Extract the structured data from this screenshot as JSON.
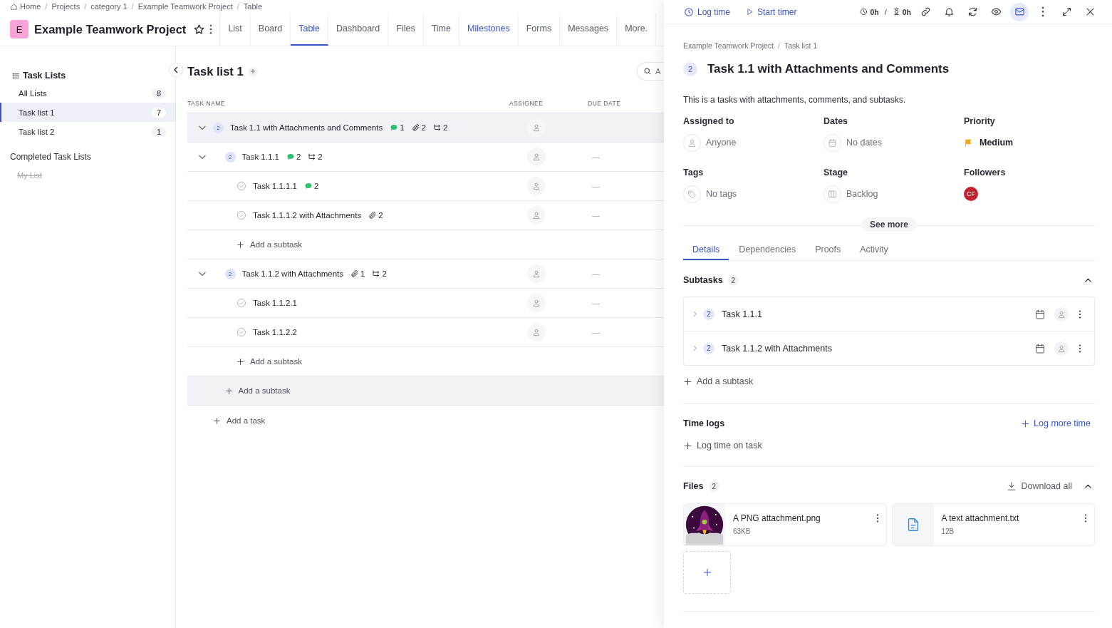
{
  "breadcrumbs": {
    "separator": "/",
    "items": [
      {
        "label": "Home",
        "kind": "home"
      },
      {
        "label": "Projects"
      },
      {
        "label": "category 1"
      },
      {
        "label": "Example Teamwork Project"
      },
      {
        "label": "Table"
      }
    ]
  },
  "project": {
    "initial": "E",
    "title": "Example Teamwork Project",
    "starred": false
  },
  "nav_tabs": [
    {
      "label": "List",
      "selected": false,
      "highlighted": false
    },
    {
      "label": "Board",
      "selected": false,
      "highlighted": false
    },
    {
      "label": "Table",
      "selected": true,
      "highlighted": false
    },
    {
      "label": "Dashboard",
      "selected": false,
      "highlighted": false
    },
    {
      "label": "Files",
      "selected": false,
      "highlighted": false
    },
    {
      "label": "Time",
      "selected": false,
      "highlighted": false
    },
    {
      "label": "Milestones",
      "selected": false,
      "highlighted": true
    },
    {
      "label": "Forms",
      "selected": false,
      "highlighted": false
    },
    {
      "label": "Messages",
      "selected": false,
      "highlighted": false
    },
    {
      "label": "More.",
      "selected": false,
      "highlighted": false
    }
  ],
  "sidebar": {
    "title": "Task Lists",
    "items": [
      {
        "label": "All Lists",
        "count": "8",
        "selected": false
      },
      {
        "label": "Task list 1",
        "count": "7",
        "selected": true
      },
      {
        "label": "Task list 2",
        "count": "1",
        "selected": false
      }
    ],
    "completed_title": "Completed Task Lists",
    "completed_items": [
      {
        "label": "My List",
        "completed": true
      }
    ]
  },
  "task_list": {
    "title": "Task list 1",
    "search_placeholder": "A",
    "columns": [
      "TASK NAME",
      "ASSIGNEE",
      "DUE DATE"
    ],
    "tasks": [
      {
        "kind": "parent",
        "name": "Task 1.1 with Attachments and Comments",
        "badge": "2",
        "selected": true,
        "expanded": true,
        "comments": "1",
        "attachments": "2",
        "subtasks": "2",
        "add_label": "Add a subtask",
        "children": [
          {
            "kind": "parent",
            "name": "Task 1.1.1",
            "badge": "2",
            "selected": false,
            "expanded": true,
            "comments": "2",
            "subtasks": "2",
            "due": "—",
            "add_label": "Add a subtask",
            "children": [
              {
                "kind": "task",
                "name": "Task 1.1.1.1",
                "selected": false,
                "completed": false,
                "comments": "2",
                "due": "—"
              },
              {
                "kind": "task",
                "name": "Task 1.1.1.2 with Attachments",
                "selected": false,
                "completed": false,
                "attachments": "2",
                "due": "—"
              }
            ]
          },
          {
            "kind": "parent",
            "name": "Task 1.1.2 with Attachments",
            "badge": "2",
            "selected": false,
            "expanded": true,
            "attachments": "1",
            "subtasks": "2",
            "due": "—",
            "add_label": "Add a subtask",
            "children": [
              {
                "kind": "task",
                "name": "Task 1.1.2.1",
                "selected": false,
                "completed": false,
                "due": "—"
              },
              {
                "kind": "task",
                "name": "Task 1.1.2.2",
                "selected": false,
                "completed": false,
                "due": "—"
              }
            ]
          }
        ]
      }
    ],
    "add_task_label": "Add a task"
  },
  "panel": {
    "toolbar": {
      "log_time": "Log time",
      "start_timer": "Start timer",
      "logged": "0h",
      "separator": "/",
      "estimated": "0h",
      "icons": [
        {
          "kind": "link",
          "selected": false
        },
        {
          "kind": "bell",
          "selected": false
        },
        {
          "kind": "refresh",
          "selected": false
        },
        {
          "kind": "eye",
          "selected": false
        },
        {
          "kind": "mail",
          "selected": true
        },
        {
          "kind": "more",
          "selected": false
        },
        {
          "kind": "expand",
          "selected": false
        },
        {
          "kind": "close",
          "selected": false
        }
      ]
    },
    "breadcrumbs": {
      "separator": "/",
      "items": [
        "Example Teamwork Project",
        "Task list 1"
      ]
    },
    "badge": "2",
    "title": "Task 1.1 with Attachments and Comments",
    "description": "This is a tasks with attachments, comments, and subtasks.",
    "fields": [
      {
        "label": "Assigned to",
        "kind": "person",
        "value": "Anyone"
      },
      {
        "label": "Dates",
        "kind": "calendar",
        "value": "No dates"
      },
      {
        "label": "Priority",
        "kind": "priority",
        "value": "Medium",
        "color": "#f5a800"
      },
      {
        "label": "Tags",
        "kind": "tag",
        "value": "No tags"
      },
      {
        "label": "Stage",
        "kind": "stage",
        "value": "Backlog"
      },
      {
        "label": "Followers",
        "kind": "followers",
        "avatars": [
          {
            "initials": "CF",
            "color": "#c3212e"
          }
        ]
      }
    ],
    "see_more": "See more",
    "tabs": [
      {
        "label": "Details",
        "selected": true
      },
      {
        "label": "Dependencies",
        "selected": false
      },
      {
        "label": "Proofs",
        "selected": false
      },
      {
        "label": "Activity",
        "selected": false
      }
    ],
    "subtasks": {
      "title": "Subtasks",
      "count": "2",
      "expanded": true,
      "items": [
        {
          "badge": "2",
          "name": "Task 1.1.1"
        },
        {
          "badge": "2",
          "name": "Task 1.1.2 with Attachments"
        }
      ],
      "add_label": "Add a subtask"
    },
    "time_logs": {
      "title": "Time logs",
      "action": "Log more time",
      "add_label": "Log time on task"
    },
    "files": {
      "title": "Files",
      "count": "2",
      "action": "Download all",
      "expanded": true,
      "items": [
        {
          "name": "A PNG attachment.png",
          "size": "63KB"
        },
        {
          "kind": "text",
          "name": "A text attachment.txt",
          "size": "12B"
        }
      ]
    }
  }
}
